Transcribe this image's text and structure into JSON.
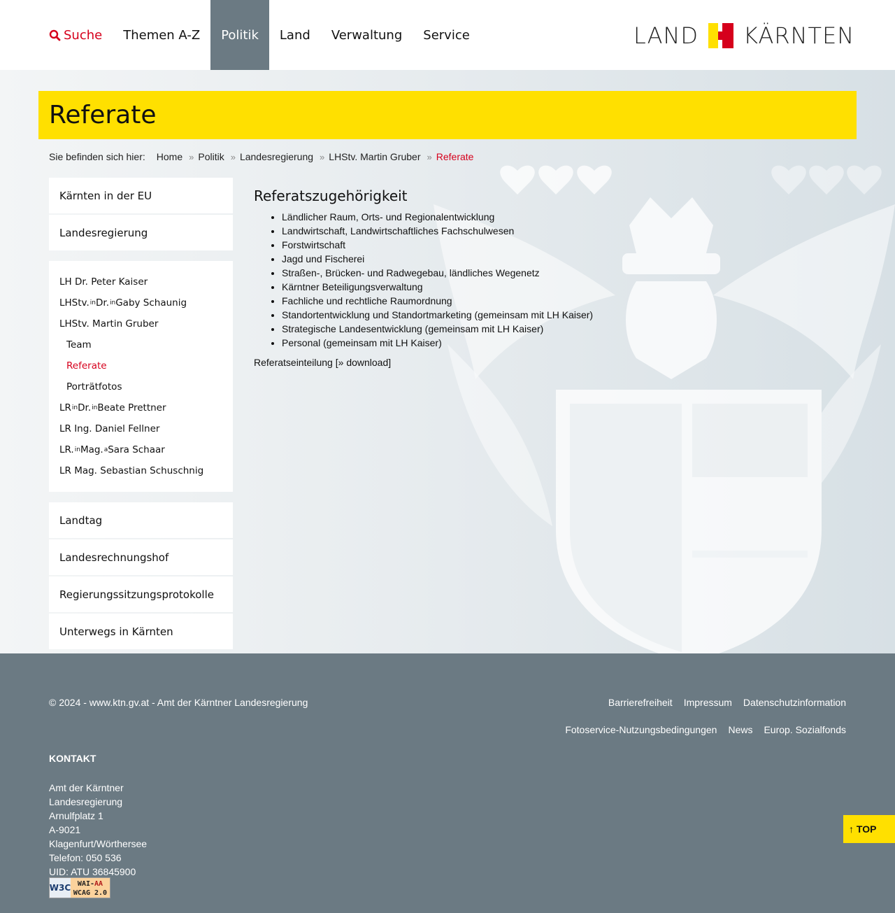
{
  "nav": {
    "search_label": "Suche",
    "items": [
      "Themen A-Z",
      "Politik",
      "Land",
      "Verwaltung",
      "Service"
    ],
    "active": "Politik"
  },
  "logo": {
    "left": "LAND",
    "right": "KÄRNTEN"
  },
  "page_title": "Referate",
  "breadcrumb": {
    "lead": "Sie befinden sich hier:",
    "items": [
      "Home",
      "Politik",
      "Landesregierung",
      "LHStv. Martin Gruber",
      "Referate"
    ]
  },
  "sidebar": {
    "top": [
      "Kärnten in der EU",
      "Landesregierung"
    ],
    "sub": {
      "lh": "LH Dr. Peter Kaiser",
      "schaunig": {
        "a": "LHStv.",
        "sup1": "in",
        "b": " Dr.",
        "sup2": "in",
        "c": " Gaby Schaunig"
      },
      "gruber": "LHStv. Martin Gruber",
      "children": [
        "Team",
        "Referate",
        "Porträtfotos"
      ],
      "prettner": {
        "a": "LR",
        "sup1": "in",
        "b": " Dr.",
        "sup2": "in",
        "c": " Beate Prettner"
      },
      "fellner": "LR Ing. Daniel Fellner",
      "schaar": {
        "a": "LR.",
        "sup1": "in",
        "b": " Mag.",
        "sup2": "a",
        "c": " Sara Schaar"
      },
      "schuschnig": "LR Mag. Sebastian Schuschnig"
    },
    "bottom": [
      "Landtag",
      "Landesrechnungshof",
      "Regierungssitzungsprotokolle",
      "Unterwegs in Kärnten"
    ]
  },
  "content": {
    "heading": "Referatszugehörigkeit",
    "items": [
      "Ländlicher Raum, Orts- und Regionalentwicklung",
      "Landwirtschaft, Landwirtschaftliches Fachschulwesen",
      "Forstwirtschaft",
      "Jagd und Fischerei",
      "Straßen-, Brücken- und Radwegebau, ländliches Wegenetz",
      "Kärntner Beteiligungsverwaltung",
      "Fachliche und rechtliche Raumordnung",
      "Standortentwicklung und Standortmarketing (gemeinsam mit LH Kaiser)",
      "Strategische Landesentwicklung (gemeinsam mit LH Kaiser)",
      "Personal (gemeinsam mit LH Kaiser)"
    ],
    "download_prefix": "Referatseinteilung [",
    "download_link": "» download",
    "download_suffix": "]"
  },
  "footer": {
    "copyright": "© 2024 - www.ktn.gv.at - Amt der Kärntner Landesregierung",
    "links": [
      "Barrierefreiheit",
      "Impressum",
      "Datenschutzinformation",
      "Fotoservice-Nutzungsbedingungen",
      "News",
      "Europ. Sozialfonds"
    ],
    "kontakt_heading": "KONTAKT",
    "kontakt_lines": [
      "Amt der Kärntner",
      "Landesregierung",
      "Arnulfplatz 1",
      "A-9021",
      "Klagenfurt/Wörthersee",
      "Telefon: 050 536",
      "UID: ATU 36845900"
    ],
    "badge": {
      "w3c": "W3C",
      "wai": "WAI-",
      "aa": "AA",
      "wcag": "WCAG 2.0"
    }
  },
  "top_button": "↑ TOP",
  "colors": {
    "brand_yellow": "#ffe000",
    "brand_red": "#d6001c",
    "nav_active": "#6b7a83",
    "footer": "#6b7a83"
  }
}
